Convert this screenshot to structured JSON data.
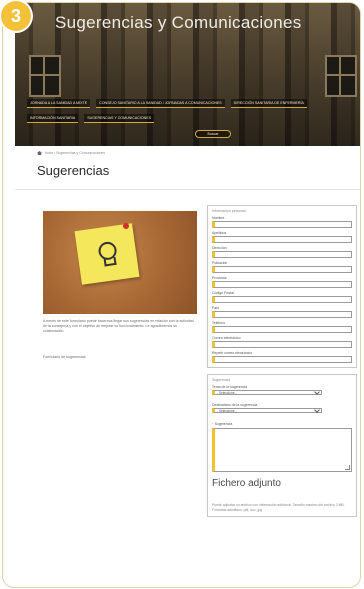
{
  "step_badge": "3",
  "hero": {
    "title": "Sugerencias y Comunicaciones",
    "nav_row1": [
      "Jornada a la Sanidad a Mixte",
      "Consejo Sanitario a la Sanidad / Jornadas a Comunicaciones",
      "Dirección Sanitaria de Enfermería"
    ],
    "nav_row2": [
      "Información Sanitaria",
      "Sugerencias y Comunicaciones"
    ],
    "button_label": "Buscar"
  },
  "breadcrumb": "Inicio / Sugerencias y Comunicaciones",
  "page_title": "Sugerencias",
  "left": {
    "description": "A través de este formulario puede hacernos llegar sus sugerencias en relación con la actividad de la consejería y con el objetivo de mejorar su funcionamiento. Le agradecemos su colaboración.",
    "link": "Formulario de sugerencias"
  },
  "form": {
    "personal_legend": "Información personal",
    "fields": [
      "Nombre",
      "Apellidos",
      "Dirección",
      "Población",
      "Provincia",
      "Código Postal",
      "País",
      "Teléfono",
      "Correo electrónico",
      "Repetir correo electrónico"
    ],
    "suggestion_legend": "Sugerencia",
    "type_label": "Tema de la sugerencia",
    "type_value": "- Seleccione -",
    "subject_label": "Destinatario de la sugerencia",
    "subject_value": "- Seleccione -",
    "text_label": "Sugerencia",
    "attachment_title": "Fichero adjunto",
    "attachment_text": "Puede adjuntar un archivo con información adicional. Tamaño máximo del archivo 2 MB. Formatos admitidos: pdf, doc, jpg."
  }
}
